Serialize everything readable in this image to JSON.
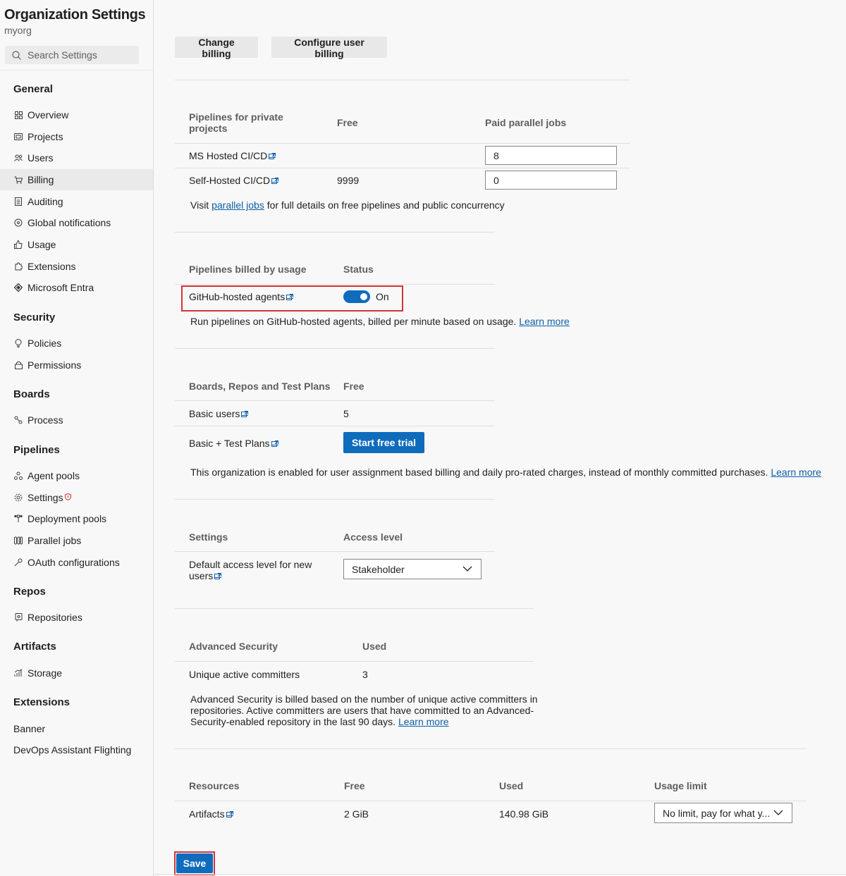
{
  "sidebar": {
    "org_title": "Organization Settings",
    "org_name": "myorg",
    "search_placeholder": "Search Settings",
    "sections": {
      "general": "General",
      "security": "Security",
      "boards": "Boards",
      "pipelines": "Pipelines",
      "repos": "Repos",
      "artifacts": "Artifacts",
      "extensions": "Extensions"
    },
    "items": {
      "overview": "Overview",
      "projects": "Projects",
      "users": "Users",
      "billing": "Billing",
      "auditing": "Auditing",
      "global_notifications": "Global notifications",
      "usage": "Usage",
      "extensions": "Extensions",
      "microsoft_entra": "Microsoft Entra",
      "policies": "Policies",
      "permissions": "Permissions",
      "process": "Process",
      "agent_pools": "Agent pools",
      "settings": "Settings",
      "deployment_pools": "Deployment pools",
      "parallel_jobs": "Parallel jobs",
      "oauth_configurations": "OAuth configurations",
      "repositories": "Repositories",
      "storage": "Storage",
      "banner": "Banner",
      "devops_assistant_flighting": "DevOps Assistant Flighting"
    },
    "selected": "billing"
  },
  "toolbar": {
    "change_billing": "Change billing",
    "configure_user_billing": "Configure user billing"
  },
  "private_pipelines": {
    "headers": [
      "Pipelines for private projects",
      "Free",
      "Paid parallel jobs"
    ],
    "rows": [
      {
        "name": "MS Hosted CI/CD",
        "free": "",
        "paid": "8"
      },
      {
        "name": "Self-Hosted CI/CD",
        "free": "9999",
        "paid": "0"
      }
    ],
    "note_prefix": "Visit ",
    "note_link": "parallel jobs",
    "note_suffix": " for full details on free pipelines and public concurrency"
  },
  "usage_pipelines": {
    "headers": [
      "Pipelines billed by usage",
      "Status"
    ],
    "row_name": "GitHub-hosted agents",
    "status": "On",
    "note_text": "Run pipelines on GitHub-hosted agents, billed per minute based on usage. ",
    "note_link": "Learn more"
  },
  "boards": {
    "headers": [
      "Boards, Repos and Test Plans",
      "Free"
    ],
    "rows": [
      {
        "name": "Basic users",
        "free": "5"
      },
      {
        "name": "Basic + Test Plans",
        "action": "Start free trial"
      }
    ],
    "note_text": "This organization is enabled for user assignment based billing and daily pro-rated charges, instead of monthly committed purchases. ",
    "note_link": "Learn more"
  },
  "access": {
    "headers": [
      "Settings",
      "Access level"
    ],
    "row_name_line1": "Default access level for new",
    "row_name_line2": "users",
    "value": "Stakeholder"
  },
  "advanced_security": {
    "headers": [
      "Advanced Security",
      "Used"
    ],
    "row_name": "Unique active committers",
    "used": "3",
    "note_line1": "Advanced Security is billed based on the number of unique active committers in",
    "note_line2": "repositories. Active committers are users that have committed to an Advanced-",
    "note_line3": "Security-enabled repository in the last 90 days. ",
    "note_link": "Learn more"
  },
  "resources": {
    "headers": [
      "Resources",
      "Free",
      "Used",
      "Usage limit"
    ],
    "row_name": "Artifacts",
    "free": "2 GiB",
    "used": "140.98 GiB",
    "limit": "No limit, pay for what y..."
  },
  "footer": {
    "save": "Save"
  },
  "colors": {
    "accent": "#0f6cbd",
    "highlight_border": "#d13438",
    "link": "#0f5ea8"
  }
}
